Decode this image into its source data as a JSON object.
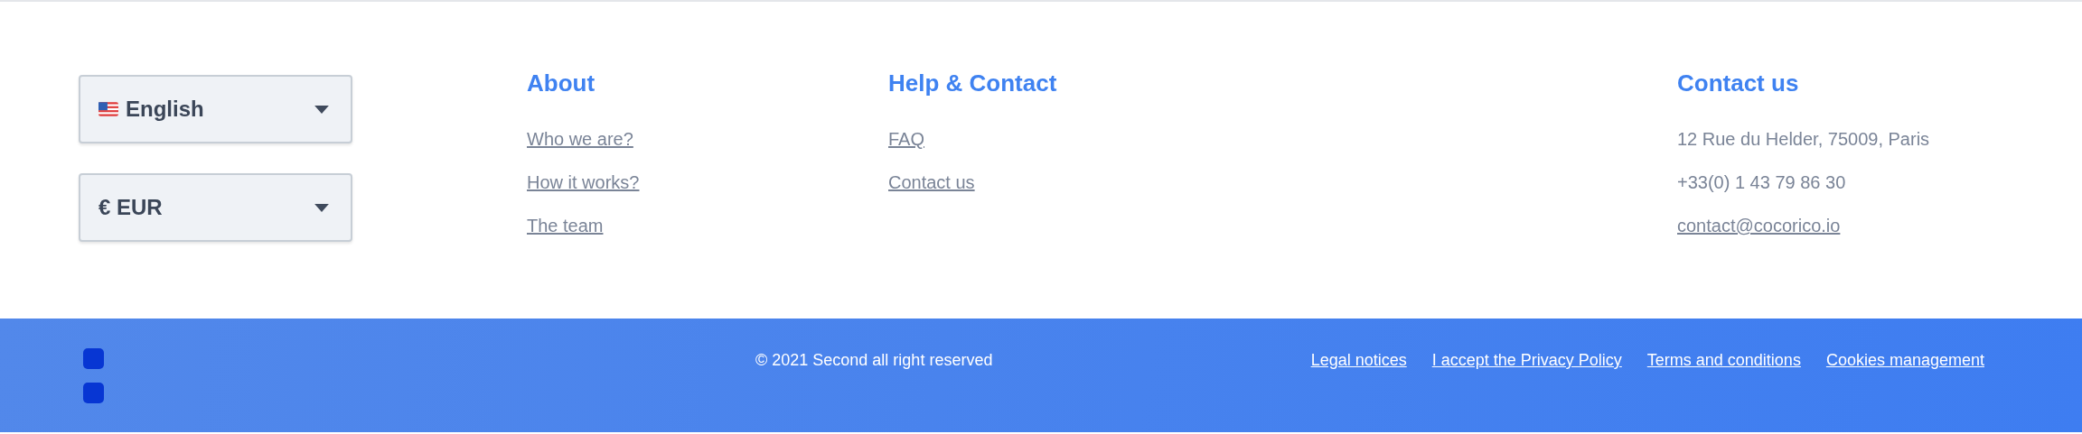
{
  "selectors": [
    {
      "kind": "language",
      "label": "English"
    },
    {
      "kind": "currency",
      "label": "€ EUR"
    }
  ],
  "columns": [
    {
      "heading": "About",
      "items": [
        {
          "text": "Who we are?",
          "link": true
        },
        {
          "text": "How it works?",
          "link": true
        },
        {
          "text": "The team",
          "link": true
        }
      ]
    },
    {
      "heading": "Help & Contact",
      "items": [
        {
          "text": "FAQ",
          "link": true
        },
        {
          "text": "Contact us",
          "link": true
        }
      ]
    },
    {
      "heading": "Contact us",
      "items": [
        {
          "text": "12 Rue du Helder, 75009, Paris",
          "link": false
        },
        {
          "text": "+33(0) 1 43 79 86 30",
          "link": false
        },
        {
          "text": "contact@cocorico.io",
          "link": true
        }
      ]
    }
  ],
  "footer": {
    "copyright": "© 2021 Second all right reserved",
    "links": [
      "Legal notices",
      "I accept the Privacy Policy",
      "Terms and conditions",
      "Cookies management"
    ]
  }
}
